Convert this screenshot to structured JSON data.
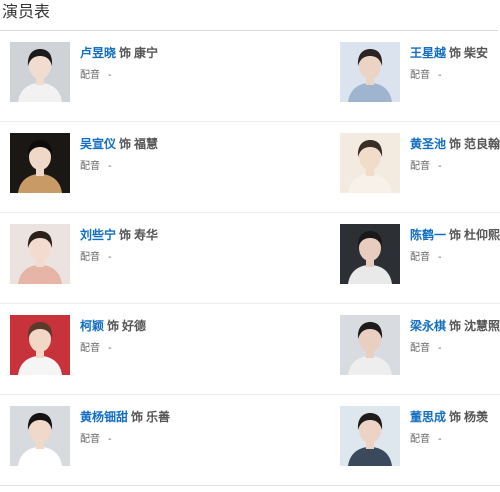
{
  "header": {
    "title": "演员表"
  },
  "rows": [
    {
      "left": {
        "actor": "卢昱晓",
        "as": "饰",
        "role": "康宁",
        "dub_label": "配音",
        "dub_value": "-",
        "bg": "#cfd3d8",
        "skin": "#f2dcd0",
        "hair": "#1c1a1a",
        "shirt": "#f2f2f2"
      },
      "right": {
        "actor": "王星越",
        "as": "饰",
        "role": "柴安",
        "dub_label": "配音",
        "dub_value": "-",
        "bg": "#dbe4ee",
        "skin": "#ecd4c4",
        "hair": "#2a2424",
        "shirt": "#9fb4cf"
      }
    },
    {
      "left": {
        "actor": "吴宣仪",
        "as": "饰",
        "role": "福慧",
        "dub_label": "配音",
        "dub_value": "-",
        "bg": "#1a1714",
        "skin": "#f0d8c8",
        "hair": "#0f0d0c",
        "shirt": "#c89a66"
      },
      "right": {
        "actor": "黄圣池",
        "as": "饰",
        "role": "范良翰",
        "dub_label": "配音",
        "dub_value": "-",
        "bg": "#f4ebe0",
        "skin": "#f1dcca",
        "hair": "#3a2f28",
        "shirt": "#f7f1ea"
      }
    },
    {
      "left": {
        "actor": "刘些宁",
        "as": "饰",
        "role": "寿华",
        "dub_label": "配音",
        "dub_value": "-",
        "bg": "#ebe3df",
        "skin": "#f3dbd0",
        "hair": "#2b201b",
        "shirt": "#e7b4a8"
      },
      "right": {
        "actor": "陈鹤一",
        "as": "饰",
        "role": "杜仰熙",
        "dub_label": "配音",
        "dub_value": "-",
        "bg": "#2c2f33",
        "skin": "#e7cdbd",
        "hair": "#1b1818",
        "shirt": "#e9e9e9"
      }
    },
    {
      "left": {
        "actor": "柯颖",
        "as": "饰",
        "role": "好德",
        "dub_label": "配音",
        "dub_value": "-",
        "bg": "#c8323a",
        "skin": "#f3d7c6",
        "hair": "#5a3a2a",
        "shirt": "#f5f5f5"
      },
      "right": {
        "actor": "梁永棋",
        "as": "饰",
        "role": "沈慧照",
        "dub_label": "配音",
        "dub_value": "-",
        "bg": "#d8dbe0",
        "skin": "#e8cfbf",
        "hair": "#1e1b1b",
        "shirt": "#eeeeee"
      }
    },
    {
      "left": {
        "actor": "黄杨钿甜",
        "as": "饰",
        "role": "乐善",
        "dub_label": "配音",
        "dub_value": "-",
        "bg": "#d7dade",
        "skin": "#f1d9ca",
        "hair": "#141212",
        "shirt": "#ffffff"
      },
      "right": {
        "actor": "董思成",
        "as": "饰",
        "role": "杨羡",
        "dub_label": "配音",
        "dub_value": "-",
        "bg": "#dfe7ee",
        "skin": "#ecd3c3",
        "hair": "#1f1b1b",
        "shirt": "#3a4a5c"
      }
    }
  ]
}
